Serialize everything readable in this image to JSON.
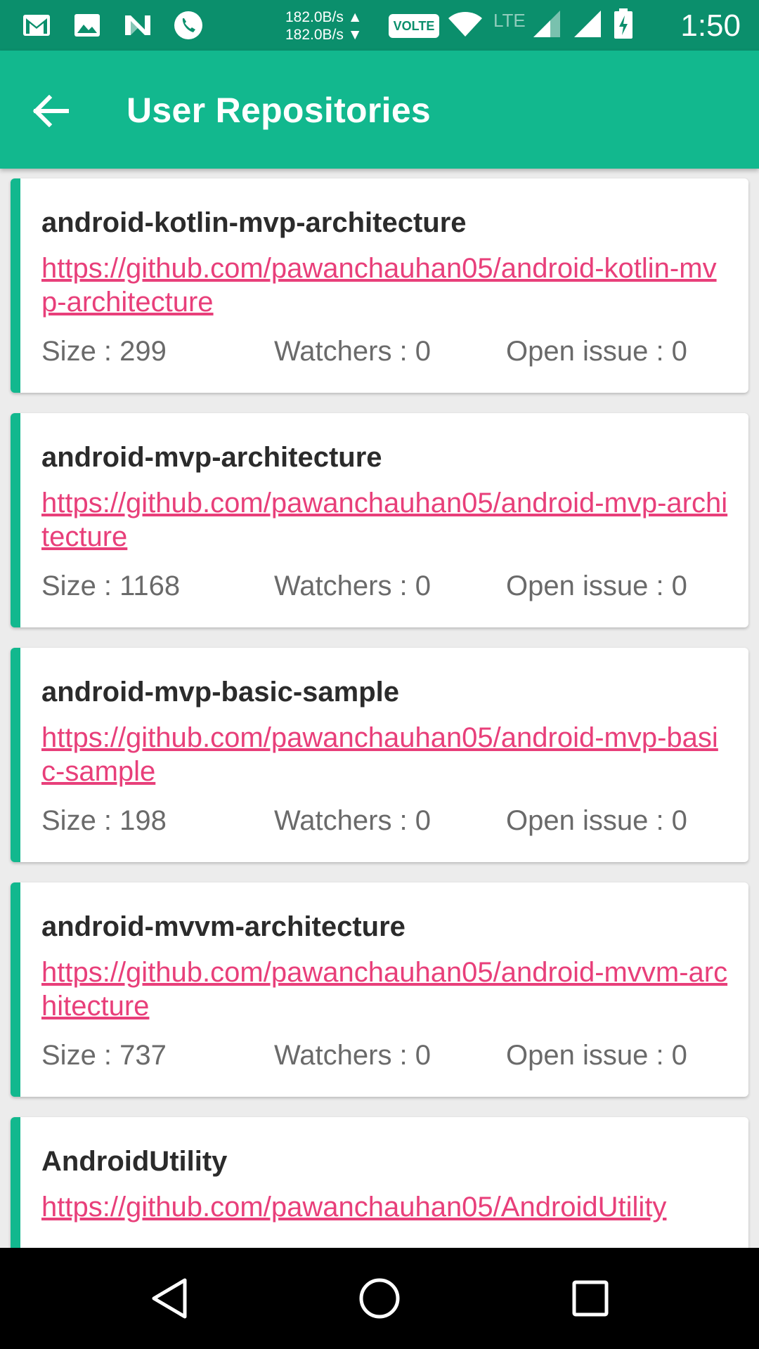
{
  "status_bar": {
    "net_up": "182.0B/s ▲",
    "net_down": "182.0B/s ▼",
    "volte": "VOLTE",
    "lte": "LTE",
    "time": "1:50",
    "icons": [
      "gmail-icon",
      "photo-icon",
      "n-icon",
      "phone-icon",
      "wifi-icon",
      "signal-icon",
      "signal-icon",
      "battery-charging-icon"
    ]
  },
  "app_bar": {
    "title": "User Repositories",
    "back_icon": "arrow-back-icon"
  },
  "repos": [
    {
      "name": "android-kotlin-mvp-architecture",
      "url": "https://github.com/pawanchauhan05/android-kotlin-mvp-architecture",
      "size": "Size : 299",
      "watchers": "Watchers : 0",
      "open_issue": "Open issue : 0"
    },
    {
      "name": "android-mvp-architecture",
      "url": "https://github.com/pawanchauhan05/android-mvp-architecture",
      "size": "Size : 1168",
      "watchers": "Watchers : 0",
      "open_issue": "Open issue : 0"
    },
    {
      "name": "android-mvp-basic-sample",
      "url": "https://github.com/pawanchauhan05/android-mvp-basic-sample",
      "size": "Size : 198",
      "watchers": "Watchers : 0",
      "open_issue": "Open issue : 0"
    },
    {
      "name": "android-mvvm-architecture",
      "url": "https://github.com/pawanchauhan05/android-mvvm-architecture",
      "size": "Size : 737",
      "watchers": "Watchers : 0",
      "open_issue": "Open issue : 0"
    },
    {
      "name": "AndroidUtility",
      "url": "https://github.com/pawanchauhan05/AndroidUtility",
      "size": "",
      "watchers": "",
      "open_issue": ""
    }
  ],
  "colors": {
    "status_bar": "#0b8f6c",
    "app_bar": "#12b88e",
    "accent_stripe": "#12b88e",
    "link": "#e83f7a"
  },
  "nav_bar": {
    "icons": [
      "back-triangle-icon",
      "home-circle-icon",
      "recents-square-icon"
    ]
  }
}
